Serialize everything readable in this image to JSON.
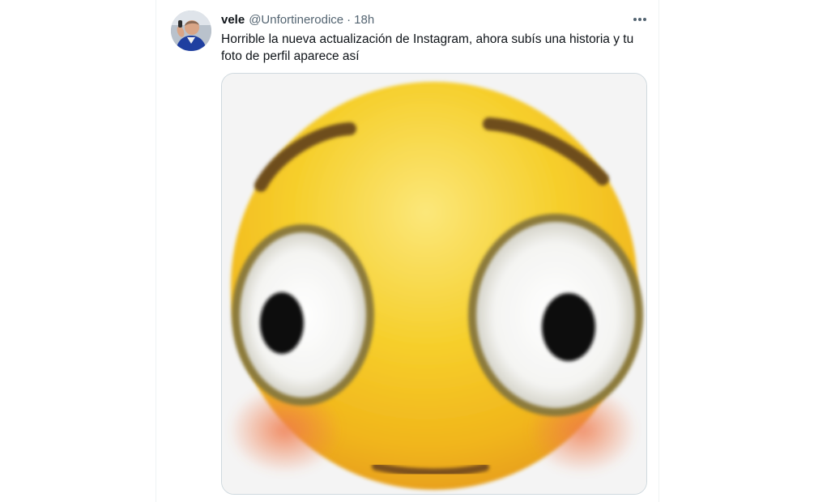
{
  "tweet": {
    "display_name": "vele",
    "handle": "@Unfortinerodice",
    "separator": "·",
    "time": "18h",
    "text": "Horrible la nueva actualización de Instagram, ahora subís una historia y tu foto de perfil aparece así",
    "more_icon": "more-horizontal-icon",
    "media": {
      "kind": "image",
      "subject": "flushed-face-emoji"
    }
  },
  "colors": {
    "name_text": "#0f1419",
    "secondary_text": "#536471",
    "media_border": "#cfd9de",
    "emoji_yellow": "#f4c520",
    "emoji_blush": "#ef8b5a"
  }
}
